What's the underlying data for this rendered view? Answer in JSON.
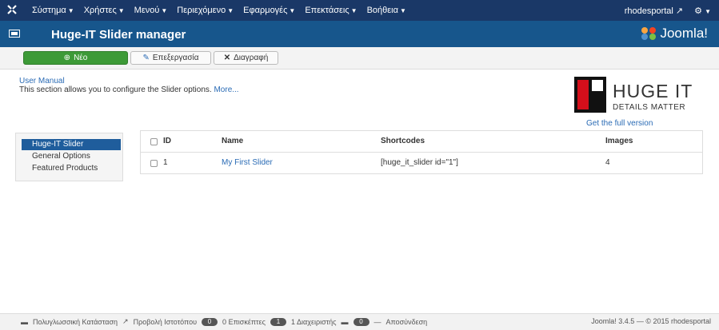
{
  "topnav": {
    "menu": [
      {
        "label": "Σύστημα"
      },
      {
        "label": "Χρήστες"
      },
      {
        "label": "Μενού"
      },
      {
        "label": "Περιεχόμενο"
      },
      {
        "label": "Εφαρμογές"
      },
      {
        "label": "Επεκτάσεις"
      },
      {
        "label": "Βοήθεια"
      }
    ],
    "user": "rhodesportal"
  },
  "header": {
    "title": "Huge-IT Slider manager",
    "brand": "Joomla!"
  },
  "toolbar": {
    "new_label": "Νέο",
    "edit_label": "Επεξεργασία",
    "delete_label": "Διαγραφή"
  },
  "info": {
    "manual": "User Manual",
    "description": "This section allows you to configure the Slider options.",
    "more": "More..."
  },
  "promo": {
    "brand_line1": "HUGE IT",
    "brand_line2": "DETAILS MATTER",
    "get_full": "Get the full version"
  },
  "sidebar": {
    "items": [
      {
        "label": "Huge-IT Slider"
      },
      {
        "label": "General Options"
      },
      {
        "label": "Featured Products"
      }
    ]
  },
  "table": {
    "headers": {
      "id": "ID",
      "name": "Name",
      "shortcodes": "Shortcodes",
      "images": "Images"
    },
    "rows": [
      {
        "id": "1",
        "name": "My First Slider",
        "shortcode": "[huge_it_slider id=\"1\"]",
        "images": "4"
      }
    ]
  },
  "status": {
    "multilang": "Πολυγλωσσική Κατάσταση",
    "view_site": "Προβολή Ιστοτόπου",
    "visitors_count": "0",
    "visitors_label": "Επισκέπτες",
    "admins_count": "1",
    "admins_label": "Διαχειριστής",
    "messages_count": "0",
    "logout": "Αποσύνδεση",
    "version": "Joomla! 3.4.5 — © 2015 rhodesportal"
  }
}
